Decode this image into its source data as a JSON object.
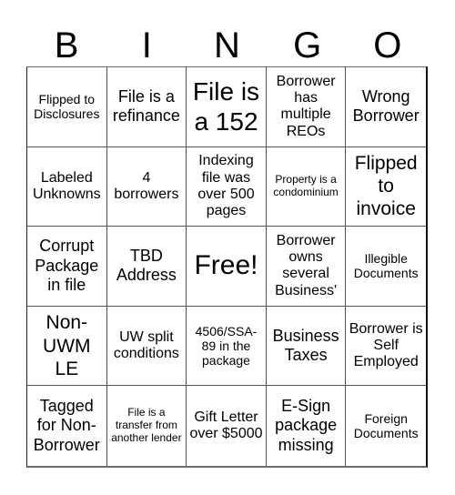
{
  "header": {
    "letters": [
      "B",
      "I",
      "N",
      "G",
      "O"
    ]
  },
  "board": {
    "cells": [
      {
        "text": "Flipped to Disclosures",
        "size": "s"
      },
      {
        "text": "File is a refinance",
        "size": "l"
      },
      {
        "text": "File is a 152",
        "size": "xxl"
      },
      {
        "text": "Borrower has multiple REOs",
        "size": "m"
      },
      {
        "text": "Wrong Borrower",
        "size": "l"
      },
      {
        "text": "Labeled Unknowns",
        "size": "m"
      },
      {
        "text": "4 borrowers",
        "size": "m"
      },
      {
        "text": "Indexing file was over 500 pages",
        "size": "m"
      },
      {
        "text": "Property is a condominium",
        "size": "xs"
      },
      {
        "text": "Flipped to invoice",
        "size": "xl"
      },
      {
        "text": "Corrupt Package in file",
        "size": "l"
      },
      {
        "text": "TBD Address",
        "size": "l"
      },
      {
        "text": "Free!",
        "size": "free",
        "free": true
      },
      {
        "text": "Borrower owns several Business'",
        "size": "m"
      },
      {
        "text": "Illegible Documents",
        "size": "s"
      },
      {
        "text": "Non-UWM LE",
        "size": "xl"
      },
      {
        "text": "UW split conditions",
        "size": "m"
      },
      {
        "text": "4506/SSA-89 in the package",
        "size": "s"
      },
      {
        "text": "Business Taxes",
        "size": "l"
      },
      {
        "text": "Borrower is Self Employed",
        "size": "m"
      },
      {
        "text": "Tagged for Non-Borrower",
        "size": "l"
      },
      {
        "text": "File is a transfer from another lender",
        "size": "xs"
      },
      {
        "text": "Gift Letter over $5000",
        "size": "m"
      },
      {
        "text": "E-Sign package missing",
        "size": "l"
      },
      {
        "text": "Foreign Documents",
        "size": "s"
      }
    ]
  }
}
